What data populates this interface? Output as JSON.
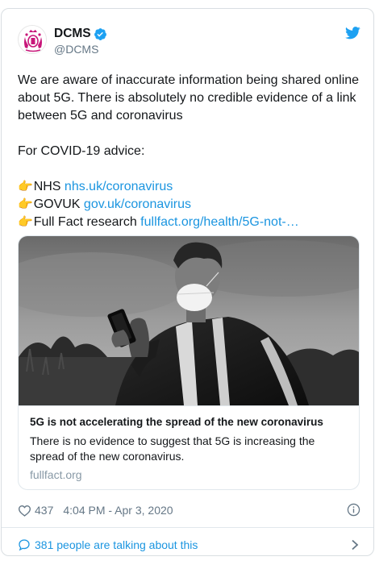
{
  "account": {
    "display_name": "DCMS",
    "handle": "@DCMS",
    "verified": true
  },
  "tweet": {
    "text_intro": "We are aware of inaccurate information being shared online about 5G. There is absolutely no credible evidence of a link between 5G and coronavirus",
    "advice_heading": "For COVID-19 advice:",
    "links": [
      {
        "emoji": "👉",
        "label": "NHS ",
        "url_text": "nhs.uk/coronavirus"
      },
      {
        "emoji": "👉",
        "label": "GOVUK ",
        "url_text": "gov.uk/coronavirus"
      },
      {
        "emoji": "👉",
        "label": "Full Fact research ",
        "url_text": "fullfact.org/health/5G-not-…"
      }
    ]
  },
  "card": {
    "title": "5G is not accelerating the spread of the new coronavirus",
    "description": "There is no evidence to suggest that 5G is increasing the spread of the new coronavirus.",
    "domain": "fullfact.org"
  },
  "meta": {
    "likes": "437",
    "timestamp": "4:04 PM - Apr 3, 2020"
  },
  "conversation": {
    "label": "381 people are talking about this"
  },
  "icons": {
    "brand_color": "#1da1f2",
    "link_color": "#1b95e0",
    "avatar": "royal-crest-icon",
    "verified": "verified-badge-icon",
    "twitter": "twitter-bird-icon",
    "like": "heart-icon",
    "info": "info-icon",
    "reply": "speech-bubble-icon",
    "chevron": "chevron-right-icon"
  }
}
